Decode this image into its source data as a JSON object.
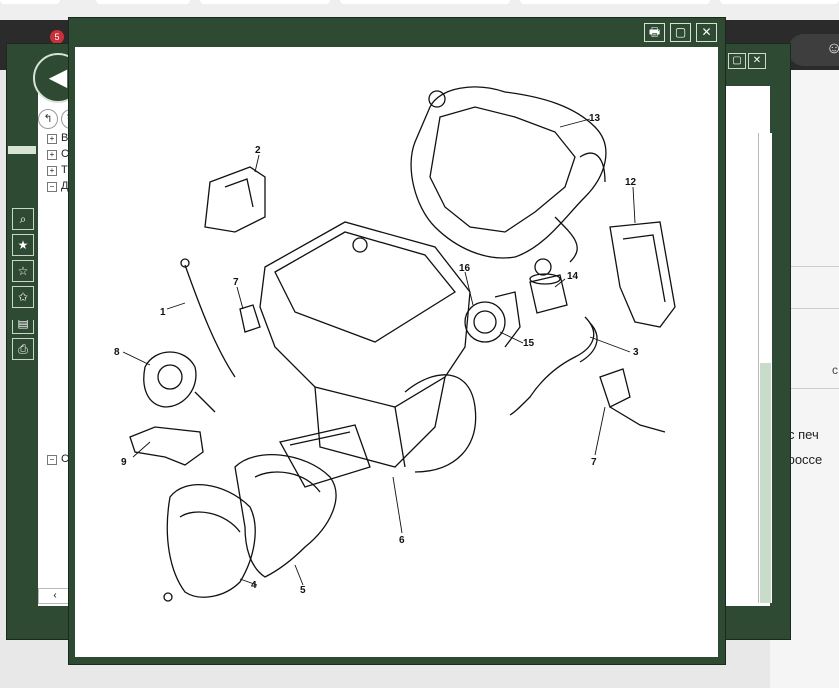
{
  "browser": {
    "badge": "5",
    "profile_icon": "profile-icon"
  },
  "back_window": {
    "nav_button": "◀",
    "small_buttons": [
      "↰",
      "↻"
    ],
    "window_buttons": [
      "▢",
      "✕"
    ],
    "tree_items": [
      {
        "toggle": "+",
        "label": "В"
      },
      {
        "toggle": "+",
        "label": "С"
      },
      {
        "toggle": "+",
        "label": "Т"
      },
      {
        "toggle": "−",
        "label": "Д"
      }
    ],
    "tree_items_lower": [
      {
        "toggle": "−",
        "label": "С"
      }
    ],
    "tools": [
      "search-icon",
      "star-icon",
      "star-add-icon",
      "star-remove-icon",
      "book-icon",
      "print-icon"
    ],
    "scroll_left": "‹",
    "scroll_up": "⌃",
    "scroll_down": "⌄"
  },
  "background_text": {
    "line1": "с печ",
    "line2": "дроссе",
    "line3": "с"
  },
  "front_window": {
    "buttons": {
      "print": "🖶",
      "restore": "▢",
      "close": "✕"
    }
  },
  "diagram": {
    "callouts": [
      "1",
      "2",
      "3",
      "4",
      "5",
      "6",
      "7",
      "7",
      "8",
      "9",
      "12",
      "13",
      "14",
      "15",
      "16"
    ]
  }
}
